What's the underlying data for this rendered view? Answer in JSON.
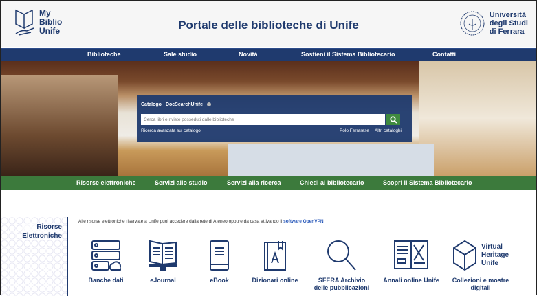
{
  "header": {
    "logo_lines": [
      "My",
      "Biblio",
      "Unife"
    ],
    "title": "Portale delle biblioteche di Unife",
    "university_lines": [
      "Università",
      "degli Studi",
      "di Ferrara"
    ]
  },
  "nav": [
    "Biblioteche",
    "Sale studio",
    "Novità",
    "Sostieni il Sistema Bibliotecario",
    "Contatti"
  ],
  "search": {
    "tabs": [
      "Catalogo",
      "DocSearchUnife"
    ],
    "placeholder": "Cerca libri e riviste posseduti dalle biblioteche",
    "advanced": "Ricerca avanzata sul catalogo",
    "links": [
      "Polo Ferrarese",
      "Altri cataloghi"
    ]
  },
  "subnav": [
    "Risorse elettroniche",
    "Servizi allo studio",
    "Servizi alla ricerca",
    "Chiedi al bibliotecario",
    "Scopri il Sistema Bibliotecario"
  ],
  "section": {
    "title_lines": [
      "Risorse",
      "Elettroniche"
    ],
    "intro": "Alle risorse elettroniche riservate a Unife puoi accedere dalla rete di Ateneo oppure da casa attivando il",
    "intro_link": "software OpenVPN",
    "resources": [
      {
        "label": "Banche dati",
        "icon": "database-cloud-icon"
      },
      {
        "label": "eJournal",
        "icon": "monitor-journal-icon"
      },
      {
        "label": "eBook",
        "icon": "ereader-icon"
      },
      {
        "label": "Dizionari online",
        "icon": "dictionary-icon"
      },
      {
        "label": "SFERA Archivio delle pubblicazioni",
        "icon": "magnifier-icon"
      },
      {
        "label": "Annali online Unife",
        "icon": "open-book-icon"
      },
      {
        "label": "Collezioni e mostre digitali",
        "icon": "cube-icon",
        "badge_lines": [
          "Virtual",
          "Heritage",
          "Unife"
        ]
      }
    ]
  },
  "colors": {
    "primary": "#1f3a6e",
    "green": "#3c7a3c"
  }
}
